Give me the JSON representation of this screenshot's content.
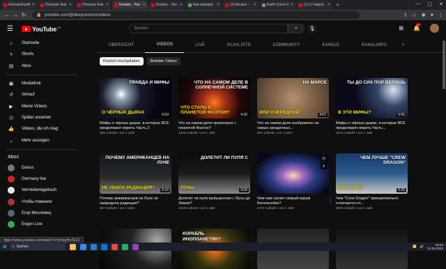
{
  "browser": {
    "tabs": [
      {
        "label": "GermanRusM",
        "fav": "#ff0000",
        "active": false
      },
      {
        "label": "Плоская Зем",
        "fav": "#ff0000",
        "active": false
      },
      {
        "label": "Плоская Зем",
        "fav": "#ff0000",
        "active": false
      },
      {
        "label": "Космос - You",
        "fav": "#ff0000",
        "active": true
      },
      {
        "label": "Космос - You",
        "fav": "#ff0000",
        "active": false
      },
      {
        "label": "Как опровер",
        "fav": "#4caf50",
        "active": false
      },
      {
        "label": "(1) Космос -",
        "fav": "#ff0000",
        "active": false
      },
      {
        "label": "Earth Curve C",
        "fav": "#888888",
        "active": false
      },
      {
        "label": "(1) 17 марта",
        "fav": "#ff0000",
        "active": false
      }
    ],
    "url": "youtube.com/@deepcosmos/videos"
  },
  "header": {
    "logo_text": "YouTube",
    "logo_region": "DE",
    "search_placeholder": "Suchen",
    "notification_count": "9+"
  },
  "sidebar": {
    "main": [
      {
        "label": "Startseite",
        "icon": "⌂"
      },
      {
        "label": "Shorts",
        "icon": "ϟ"
      },
      {
        "label": "Abos",
        "icon": "▤"
      }
    ],
    "library": [
      {
        "label": "Mediathek",
        "icon": "▣"
      },
      {
        "label": "Verlauf",
        "icon": "↺"
      },
      {
        "label": "Meine Videos",
        "icon": "▶"
      },
      {
        "label": "Später ansehen",
        "icon": "◷"
      },
      {
        "label": "Videos, die ich mag",
        "icon": "👍"
      },
      {
        "label": "Mehr anzeigen",
        "icon": "⌄"
      }
    ],
    "subs_heading": "Abos",
    "subs": [
      {
        "label": "Darius",
        "color": "#777777"
      },
      {
        "label": "Germany live",
        "color": "#cc2222"
      },
      {
        "label": "Vermietertagebuch",
        "color": "#e8e8e8"
      },
      {
        "label": "Чтобы помнили",
        "color": "#aa3333"
      },
      {
        "label": "Егор Мисливец",
        "color": "#556677"
      },
      {
        "label": "Evgen Live",
        "color": "#33aa55"
      }
    ]
  },
  "channel_tabs": [
    "ÜBERSICHT",
    "VIDEOS",
    "LIVE",
    "PLAYLISTS",
    "COMMUNITY",
    "KANÄLE",
    "KANALINFO"
  ],
  "active_tab": "VIDEOS",
  "chips": [
    "Kürzlich hochgeladen",
    "Beliebte Videos"
  ],
  "videos": [
    {
      "title": "Мифы о чёрных дырах, в которые ВСЕ продолжают верить Часть 2",
      "meta": "905 Aufrufe • vor 1 Jahr",
      "duration": "6:53",
      "thumb_top": "ПРАВДА И МИФЫ",
      "thumb_bottom": "О ЧЁРНЫХ ДЫРАХ"
    },
    {
      "title": "Что на самом деле произошло с планетой Фаэтон?",
      "meta": "1216 Aufrufe • vor 1 Jahr",
      "duration": "4:32",
      "thumb_top": "ЧТО НА САМОМ ДЕЛЕ В СОЛНЕЧНОЙ СИСТЕМЕ",
      "thumb_bottom": "ЧТО СТАЛО С ПЛАНЕТОЙ ФАЭТОН?"
    },
    {
      "title": "Что на самом деле изображено на самых загадочных...",
      "meta": "607 Aufrufe • vor 1 Jahr",
      "duration": "4:57",
      "thumb_top": "НА МАРСЕ",
      "thumb_bottom": "ИЛИ ОЧЕРЕДНОЙ"
    },
    {
      "title": "Мифы о чёрных дырах, в которые ВСЕ продолжают верить Часть...",
      "meta": "1271 Aufrufe • vor 1 Jahr",
      "duration": "6:55",
      "thumb_top": "ТЫ ДО СИХ ПОР ВЕРИШЬ",
      "thumb_bottom": "В ЭТИ МИФЫ?"
    },
    {
      "title": "Почему американцев на Луне не навредила радиация?",
      "meta": "967 Aufrufe • vor 1 Jahr",
      "duration": "5:10",
      "thumb_top": "ПОЧЕМУ АМЕРИКАНЦЕВ НА ЛУНЕ",
      "thumb_bottom": "НЕ УБИЛА РАДИАЦИЯ?"
    },
    {
      "title": "Долетит ли пуля выпущенная с Луны до Земли?",
      "meta": "1219 Aufrufe • vor 1 Jahr",
      "duration": "3:26",
      "thumb_top": "ДОЛЕТИТ ЛИ ПУЛЯ С",
      "thumb_bottom": "ЛУНЫ"
    },
    {
      "title": "Чем нам грозит скорый взрыв Бетельгейзе?",
      "meta": "1707 Aufrufe • vor 1 Jahr",
      "duration": "",
      "thumb_top": "",
      "thumb_bottom": ""
    },
    {
      "title": "Чем \"Crew Dragon\" принципиально отличается от...",
      "meta": "3876 Aufrufe • vor 1 Jahr",
      "duration": "5:25",
      "thumb_top": "ЧЕМ ЛУЧШЕ \"CREW DRAGON\"",
      "thumb_bottom": "ИЛИ СОЮЗ"
    }
  ],
  "bottom_thumbs": [
    {
      "top": "",
      "bottom": ""
    },
    {
      "top": "КОРАБЛЬ",
      "bottom": "ИНОПЛАНЕТЯН?"
    },
    {
      "top": "",
      "bottom": ""
    },
    {
      "top": "",
      "bottom": ""
    }
  ],
  "status_url": "https://www.youtube.com/watch?v=jVheyHe7E1U",
  "taskbar": {
    "search_label": "Suchen",
    "time": "20:54",
    "date": "21.05.2023"
  }
}
